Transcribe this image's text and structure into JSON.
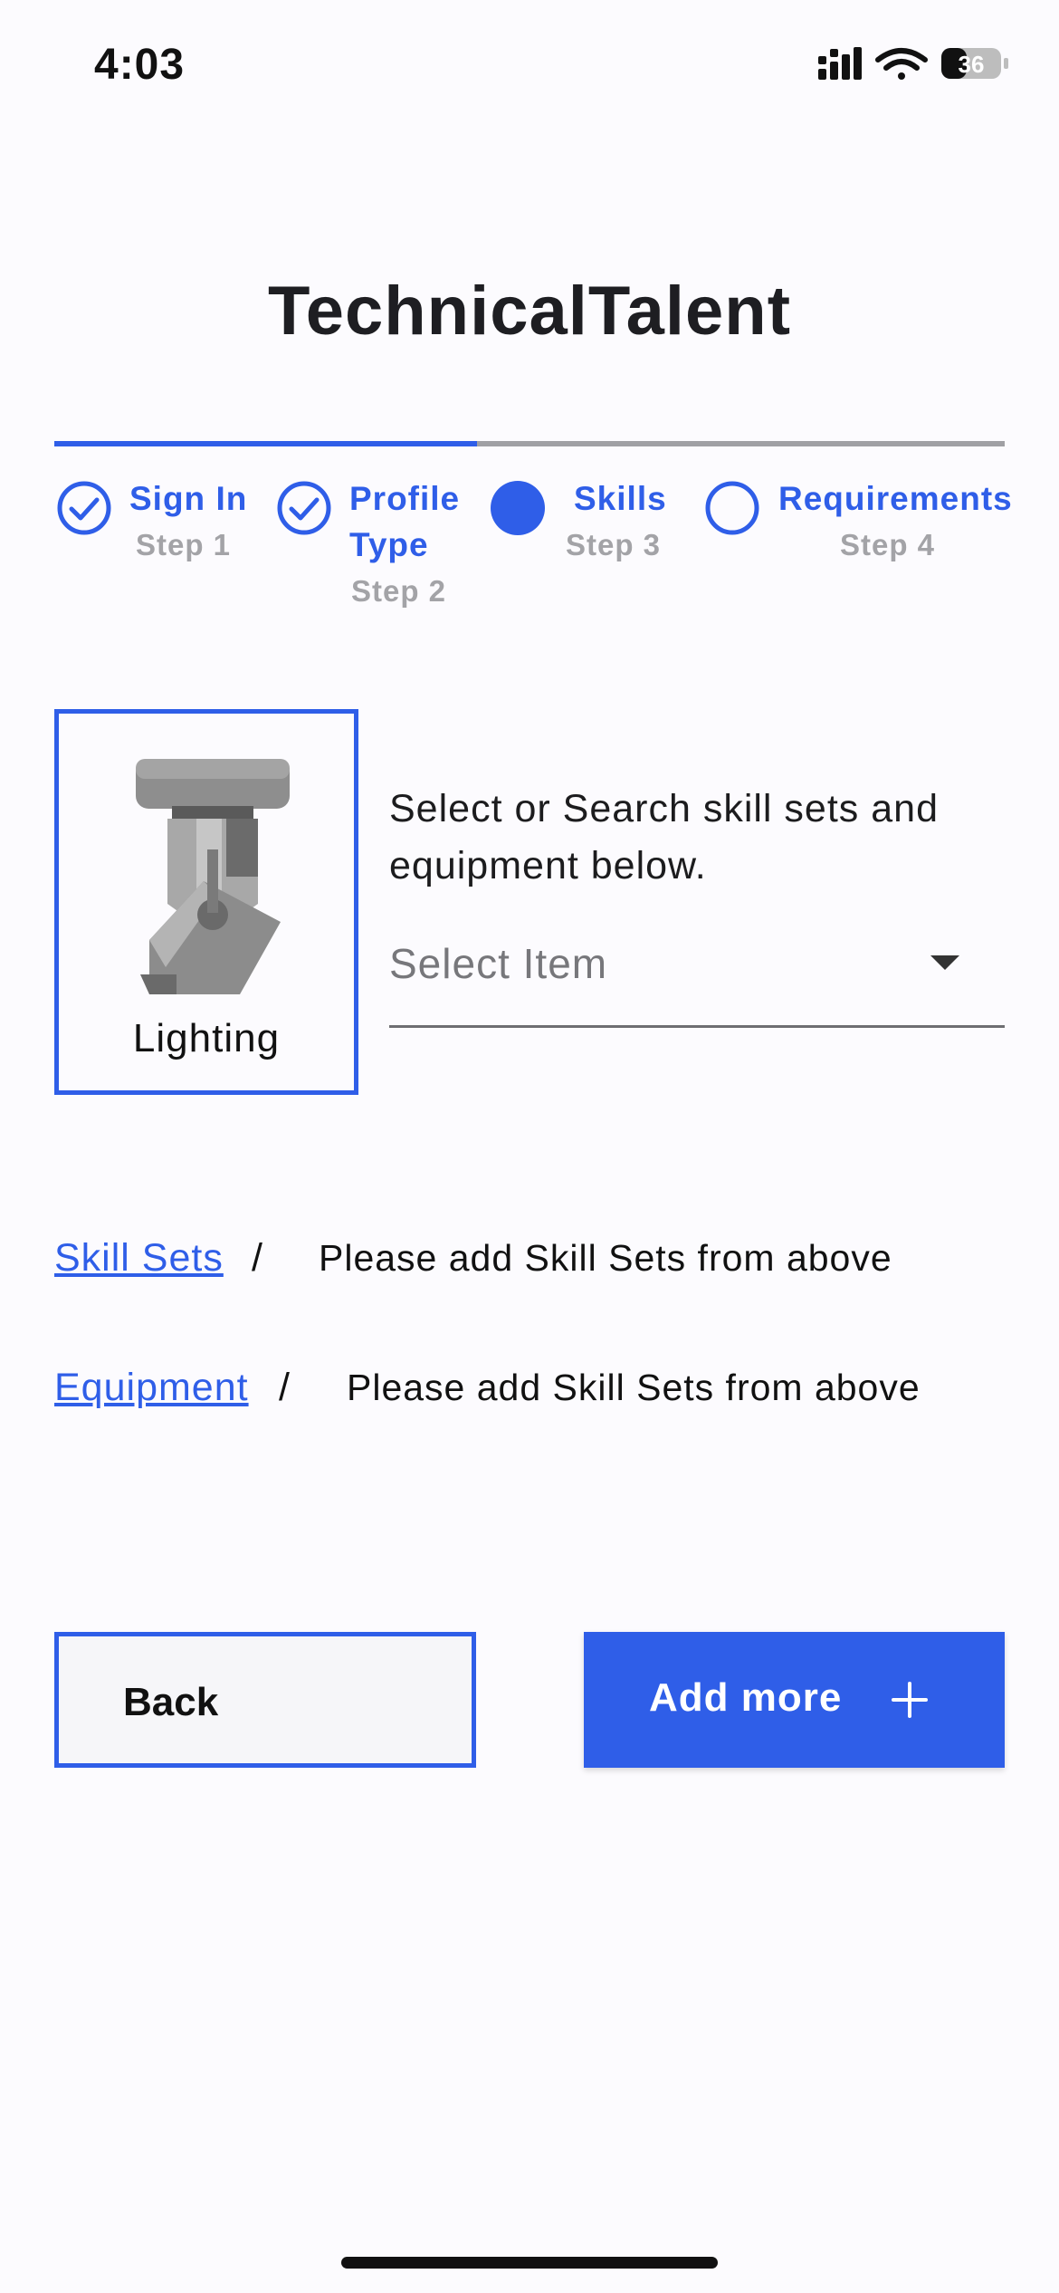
{
  "status_bar": {
    "time": "4:03",
    "battery": "36",
    "icons": [
      "signal-icon",
      "wifi-icon",
      "battery-icon"
    ]
  },
  "title": "TechnicalTalent",
  "stepper": {
    "progress_fraction": 0.44,
    "steps": [
      {
        "label_line1": "Sign In",
        "label_line2": "",
        "sub": "Step 1",
        "state": "completed"
      },
      {
        "label_line1": "Profile",
        "label_line2": "Type",
        "sub": "Step 2",
        "state": "completed"
      },
      {
        "label_line1": "Skills",
        "label_line2": "",
        "sub": "Step 3",
        "state": "active"
      },
      {
        "label_line1": "Requirements",
        "label_line2": "",
        "sub": "Step 4",
        "state": "pending"
      }
    ]
  },
  "skill_card": {
    "label": "Lighting",
    "icon": "stage-light-icon"
  },
  "instructions": "Select or Search skill sets and equipment below.",
  "select": {
    "value": "Select Item"
  },
  "rows": {
    "skill_sets": {
      "link": "Skill Sets ",
      "separator": "/",
      "message": "Please add Skill Sets from above"
    },
    "equipment": {
      "link": "Equipment ",
      "separator": "/",
      "message": "Please add Skill Sets from above"
    }
  },
  "buttons": {
    "back": "Back",
    "add_more": "Add more"
  },
  "colors": {
    "accent": "#2f5ee8",
    "muted": "#a3a3a7",
    "background": "#fcfbfe"
  }
}
